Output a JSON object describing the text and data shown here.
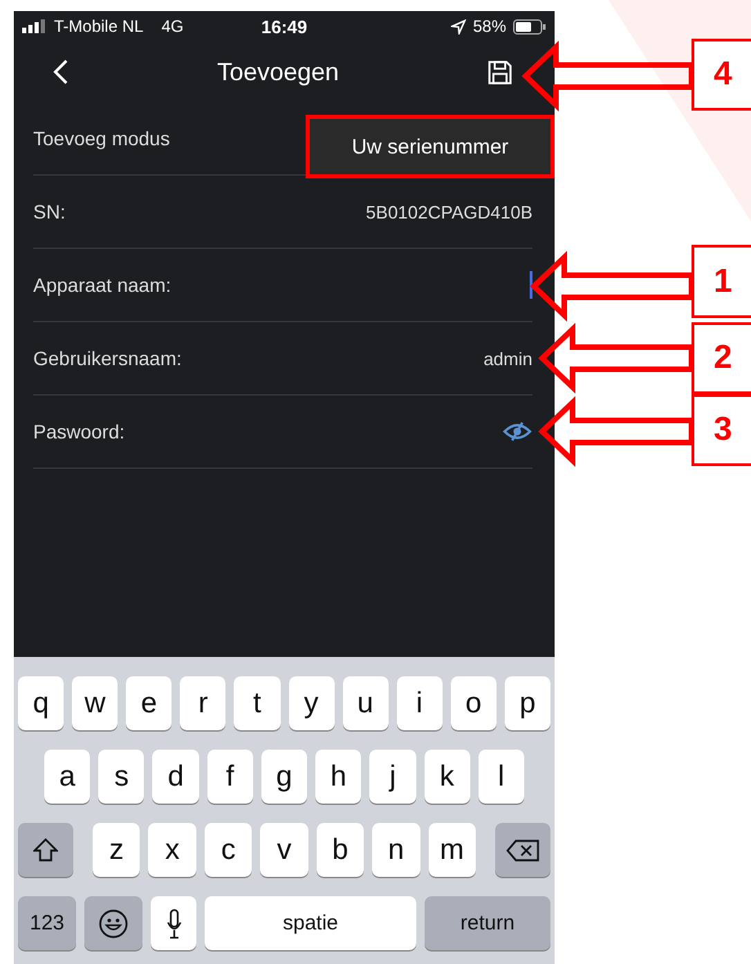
{
  "status_bar": {
    "carrier": "T-Mobile NL",
    "network": "4G",
    "time": "16:49",
    "battery": "58%"
  },
  "nav": {
    "title": "Toevoegen"
  },
  "form": [
    {
      "kind": "select",
      "label": "Toevoeg modus",
      "value": "Uw serienummer"
    },
    {
      "kind": "text",
      "label": "SN:",
      "value": "5B0102CPAGD410B"
    },
    {
      "kind": "input",
      "label": "Apparaat naam:",
      "focused": true
    },
    {
      "kind": "input",
      "label": "Gebruikersnaam:",
      "value": "admin",
      "focused": false
    },
    {
      "kind": "password",
      "label": "Paswoord:"
    }
  ],
  "keyboard": [
    [
      {
        "kind": "letter",
        "label": "q"
      },
      {
        "kind": "letter",
        "label": "w"
      },
      {
        "kind": "letter",
        "label": "e"
      },
      {
        "kind": "letter",
        "label": "r"
      },
      {
        "kind": "letter",
        "label": "t"
      },
      {
        "kind": "letter",
        "label": "y"
      },
      {
        "kind": "letter",
        "label": "u"
      },
      {
        "kind": "letter",
        "label": "i"
      },
      {
        "kind": "letter",
        "label": "o"
      },
      {
        "kind": "letter",
        "label": "p"
      }
    ],
    [
      {
        "kind": "letter",
        "label": "a"
      },
      {
        "kind": "letter",
        "label": "s"
      },
      {
        "kind": "letter",
        "label": "d"
      },
      {
        "kind": "letter",
        "label": "f"
      },
      {
        "kind": "letter",
        "label": "g"
      },
      {
        "kind": "letter",
        "label": "h"
      },
      {
        "kind": "letter",
        "label": "j"
      },
      {
        "kind": "letter",
        "label": "k"
      },
      {
        "kind": "letter",
        "label": "l"
      }
    ],
    [
      {
        "kind": "shift"
      },
      {
        "kind": "letter",
        "label": "z"
      },
      {
        "kind": "letter",
        "label": "x"
      },
      {
        "kind": "letter",
        "label": "c"
      },
      {
        "kind": "letter",
        "label": "v"
      },
      {
        "kind": "letter",
        "label": "b"
      },
      {
        "kind": "letter",
        "label": "n"
      },
      {
        "kind": "letter",
        "label": "m"
      },
      {
        "kind": "backspace"
      }
    ],
    [
      {
        "kind": "numbers",
        "label": "123"
      },
      {
        "kind": "emoji"
      },
      {
        "kind": "mic"
      },
      {
        "kind": "space",
        "label": "spatie"
      },
      {
        "kind": "return",
        "label": "return"
      }
    ]
  ],
  "callouts": [
    {
      "number": "4"
    },
    {
      "number": "1"
    },
    {
      "number": "2"
    },
    {
      "number": "3"
    }
  ]
}
